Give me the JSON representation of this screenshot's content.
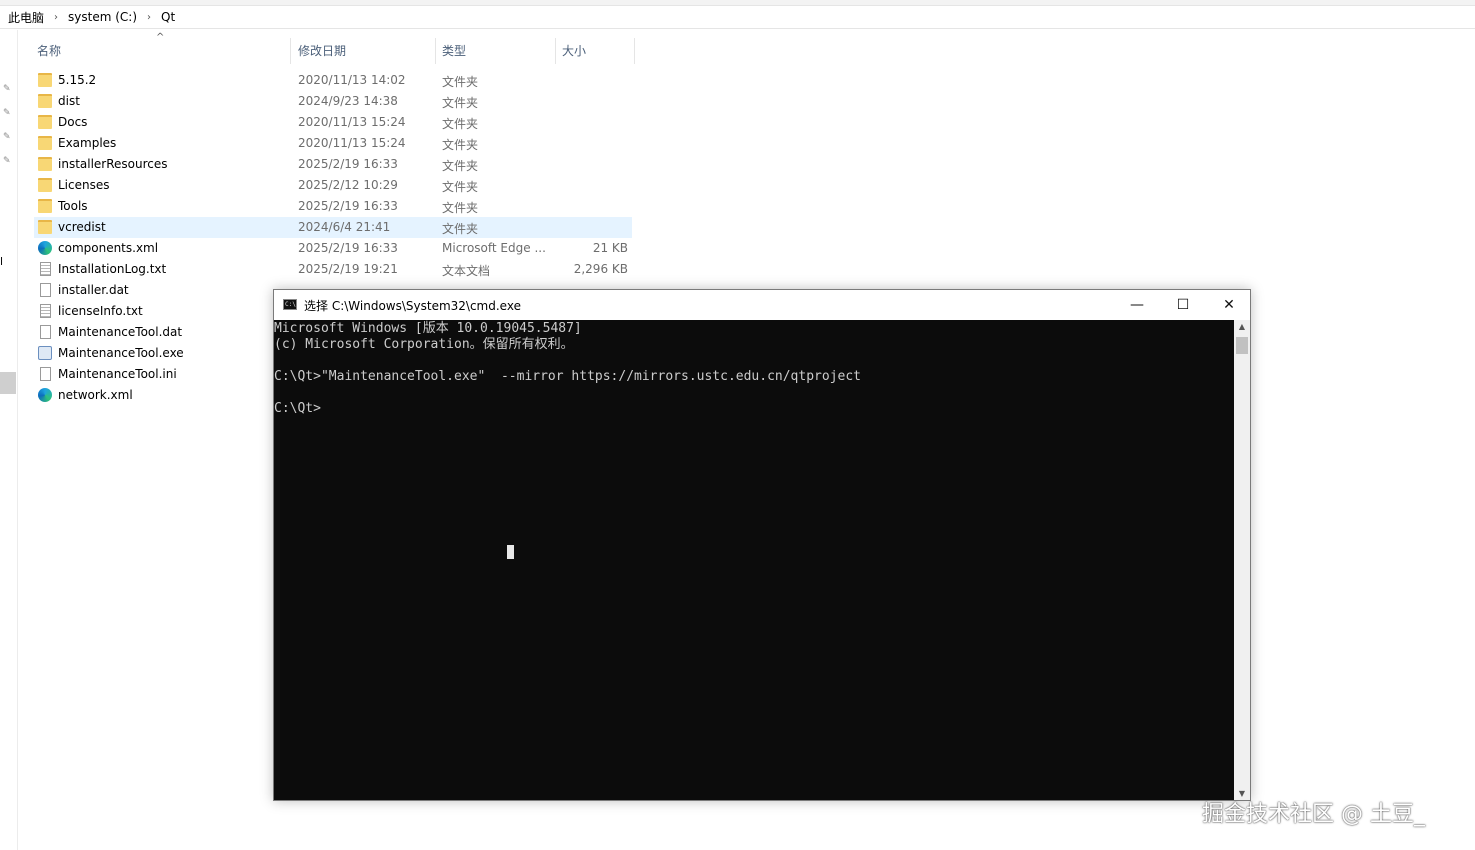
{
  "breadcrumb": [
    "此电脑",
    "system (C:)",
    "Qt"
  ],
  "breadcrumb_sep": "›",
  "nav_truncated_label": "l",
  "columns": {
    "name": "名称",
    "date": "修改日期",
    "type": "类型",
    "size": "大小"
  },
  "sort_indicator": "^",
  "files": [
    {
      "name": "5.15.2",
      "date": "2020/11/13 14:02",
      "type": "文件夹",
      "size": "",
      "icon": "folder-icon"
    },
    {
      "name": "dist",
      "date": "2024/9/23 14:38",
      "type": "文件夹",
      "size": "",
      "icon": "folder-icon"
    },
    {
      "name": "Docs",
      "date": "2020/11/13 15:24",
      "type": "文件夹",
      "size": "",
      "icon": "folder-icon"
    },
    {
      "name": "Examples",
      "date": "2020/11/13 15:24",
      "type": "文件夹",
      "size": "",
      "icon": "folder-icon"
    },
    {
      "name": "installerResources",
      "date": "2025/2/19 16:33",
      "type": "文件夹",
      "size": "",
      "icon": "folder-icon"
    },
    {
      "name": "Licenses",
      "date": "2025/2/12 10:29",
      "type": "文件夹",
      "size": "",
      "icon": "folder-icon"
    },
    {
      "name": "Tools",
      "date": "2025/2/19 16:33",
      "type": "文件夹",
      "size": "",
      "icon": "folder-icon"
    },
    {
      "name": "vcredist",
      "date": "2024/6/4 21:41",
      "type": "文件夹",
      "size": "",
      "icon": "folder-icon",
      "selected": true
    },
    {
      "name": "components.xml",
      "date": "2025/2/19 16:33",
      "type": "Microsoft Edge ...",
      "size": "21 KB",
      "icon": "edge-icon"
    },
    {
      "name": "InstallationLog.txt",
      "date": "2025/2/19 19:21",
      "type": "文本文档",
      "size": "2,296 KB",
      "icon": "text-file-icon"
    },
    {
      "name": "installer.dat",
      "date": "",
      "type": "",
      "size": "",
      "icon": "file-icon"
    },
    {
      "name": "licenseInfo.txt",
      "date": "",
      "type": "",
      "size": "",
      "icon": "text-file-icon"
    },
    {
      "name": "MaintenanceTool.dat",
      "date": "",
      "type": "",
      "size": "",
      "icon": "file-icon"
    },
    {
      "name": "MaintenanceTool.exe",
      "date": "",
      "type": "",
      "size": "",
      "icon": "exe-icon"
    },
    {
      "name": "MaintenanceTool.ini",
      "date": "",
      "type": "",
      "size": "",
      "icon": "config-file-icon"
    },
    {
      "name": "network.xml",
      "date": "",
      "type": "",
      "size": "",
      "icon": "edge-icon"
    }
  ],
  "cmd": {
    "title": "选择 C:\\Windows\\System32\\cmd.exe",
    "icon_text": "C:\\",
    "minimize": "—",
    "maximize": "☐",
    "close": "✕",
    "lines": [
      "Microsoft Windows [版本 10.0.19045.5487]",
      "(c) Microsoft Corporation。保留所有权利。",
      "",
      "C:\\Qt>\"MaintenanceTool.exe\"  --mirror https://mirrors.ustc.edu.cn/qtproject",
      "",
      "C:\\Qt>"
    ],
    "scroll_up": "▲",
    "scroll_down": "▼"
  },
  "watermark": "掘金技术社区 @ 土豆_"
}
